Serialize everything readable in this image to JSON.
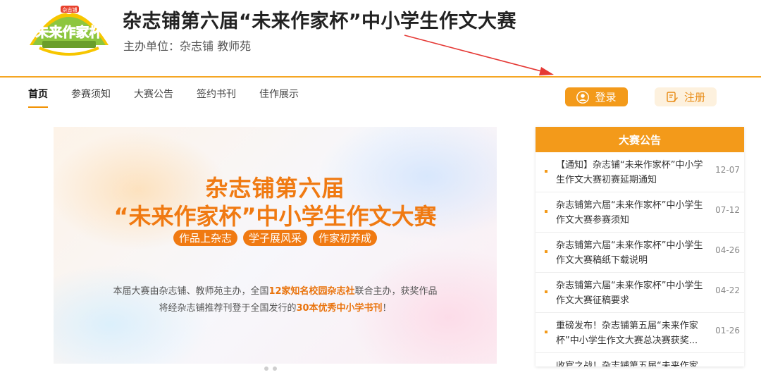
{
  "header": {
    "logo_text": "未来作家杯",
    "logo_badge": "杂志铺",
    "title": "杂志铺第六届“未来作家杯”中小学生作文大赛",
    "subtitle": "主办单位：杂志铺 教师苑"
  },
  "nav": {
    "items": [
      {
        "label": "首页",
        "active": true
      },
      {
        "label": "参赛须知"
      },
      {
        "label": "大赛公告"
      },
      {
        "label": "签约书刊"
      },
      {
        "label": "佳作展示"
      }
    ],
    "login_label": "登录",
    "register_label": "注册"
  },
  "banner": {
    "title_line1": "杂志铺第六届",
    "title_line2": "“未来作家杯”中小学生作文大赛",
    "tags": [
      "作品上杂志",
      "学子展风采",
      "作家初养成"
    ],
    "desc1_a": "本届大赛由杂志铺、教师苑主办，全国",
    "desc1_hl": "12家知名校园杂志社",
    "desc1_b": "联合主办，获奖作品",
    "desc2_a": "将经杂志铺推荐刊登于全国发行的",
    "desc2_hl": "30本优秀中小学书刊",
    "desc2_b": "！"
  },
  "notice_panel": {
    "title": "大赛公告",
    "items": [
      {
        "title": "【通知】杂志铺“未来作家杯”中小学生作文大赛初赛延期通知",
        "date": "12-07"
      },
      {
        "title": "杂志铺第六届“未来作家杯”中小学生作文大赛参赛须知",
        "date": "07-12"
      },
      {
        "title": "杂志铺第六届“未来作家杯”中小学生作文大赛稿纸下载说明",
        "date": "04-26"
      },
      {
        "title": "杂志铺第六届“未来作家杯”中小学生作文大赛征稿要求",
        "date": "04-22"
      },
      {
        "title": "重磅发布！杂志铺第五届“未来作家杯”中小学生作文大赛总决赛获奖...",
        "date": "01-26"
      },
      {
        "title": "收官之战！杂志铺第五届“未来作家",
        "date": ""
      }
    ]
  },
  "colors": {
    "accent": "#f39a1a",
    "banner_text": "#f07a12"
  }
}
